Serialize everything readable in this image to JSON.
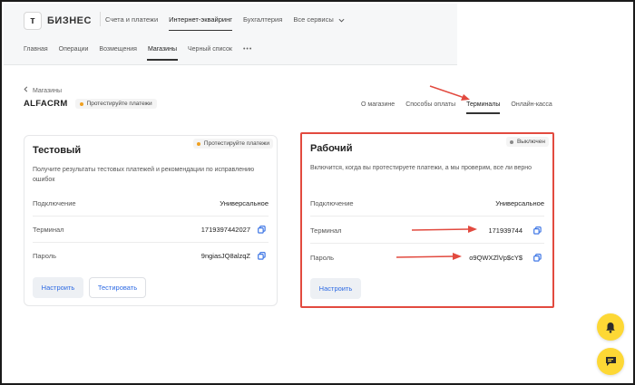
{
  "brand": {
    "mark": "т",
    "name": "БИЗНЕС"
  },
  "main_nav": [
    {
      "label": "Счета и платежи"
    },
    {
      "label": "Интернет-эквайринг"
    },
    {
      "label": "Бухгалтерия"
    },
    {
      "label": "Все сервисы"
    }
  ],
  "sub_nav": [
    {
      "label": "Главная"
    },
    {
      "label": "Операции"
    },
    {
      "label": "Возмещения"
    },
    {
      "label": "Магазины"
    },
    {
      "label": "Черный список"
    }
  ],
  "sub_nav_more": "•••",
  "breadcrumb": {
    "label": "Магазины"
  },
  "shop": {
    "name": "ALFACRM",
    "badge": "Протестируйте платежи"
  },
  "shop_tabs": [
    {
      "label": "О магазине"
    },
    {
      "label": "Способы оплаты"
    },
    {
      "label": "Терминалы"
    },
    {
      "label": "Онлайн-касса"
    }
  ],
  "test_card": {
    "title": "Тестовый",
    "badge": "Протестируйте платежи",
    "description": "Получите результаты тестовых платежей и рекомендации по исправлению ошибок",
    "rows": [
      {
        "label": "Подключение",
        "value": "Универсальное"
      },
      {
        "label": "Терминал",
        "value": "1719397442027"
      },
      {
        "label": "Пароль",
        "value": "9ngiasJQ8alzqZ"
      }
    ],
    "configure_button": "Настроить",
    "test_button": "Тестировать"
  },
  "prod_card": {
    "title": "Рабочий",
    "badge": "Выключен",
    "description": "Включится, когда вы протестируете платежи, а мы проверим, все ли верно",
    "rows": [
      {
        "label": "Подключение",
        "value": "Универсальное"
      },
      {
        "label": "Терминал",
        "value": "171939744"
      },
      {
        "label": "Пароль",
        "value": "o9QWXZlVp$cY$"
      }
    ],
    "configure_button": "Настроить"
  },
  "colors": {
    "accent": "#2d6ae3",
    "highlight": "#e24a3f",
    "fab": "#fdd835",
    "test_badge_dot": "#f0a020"
  }
}
